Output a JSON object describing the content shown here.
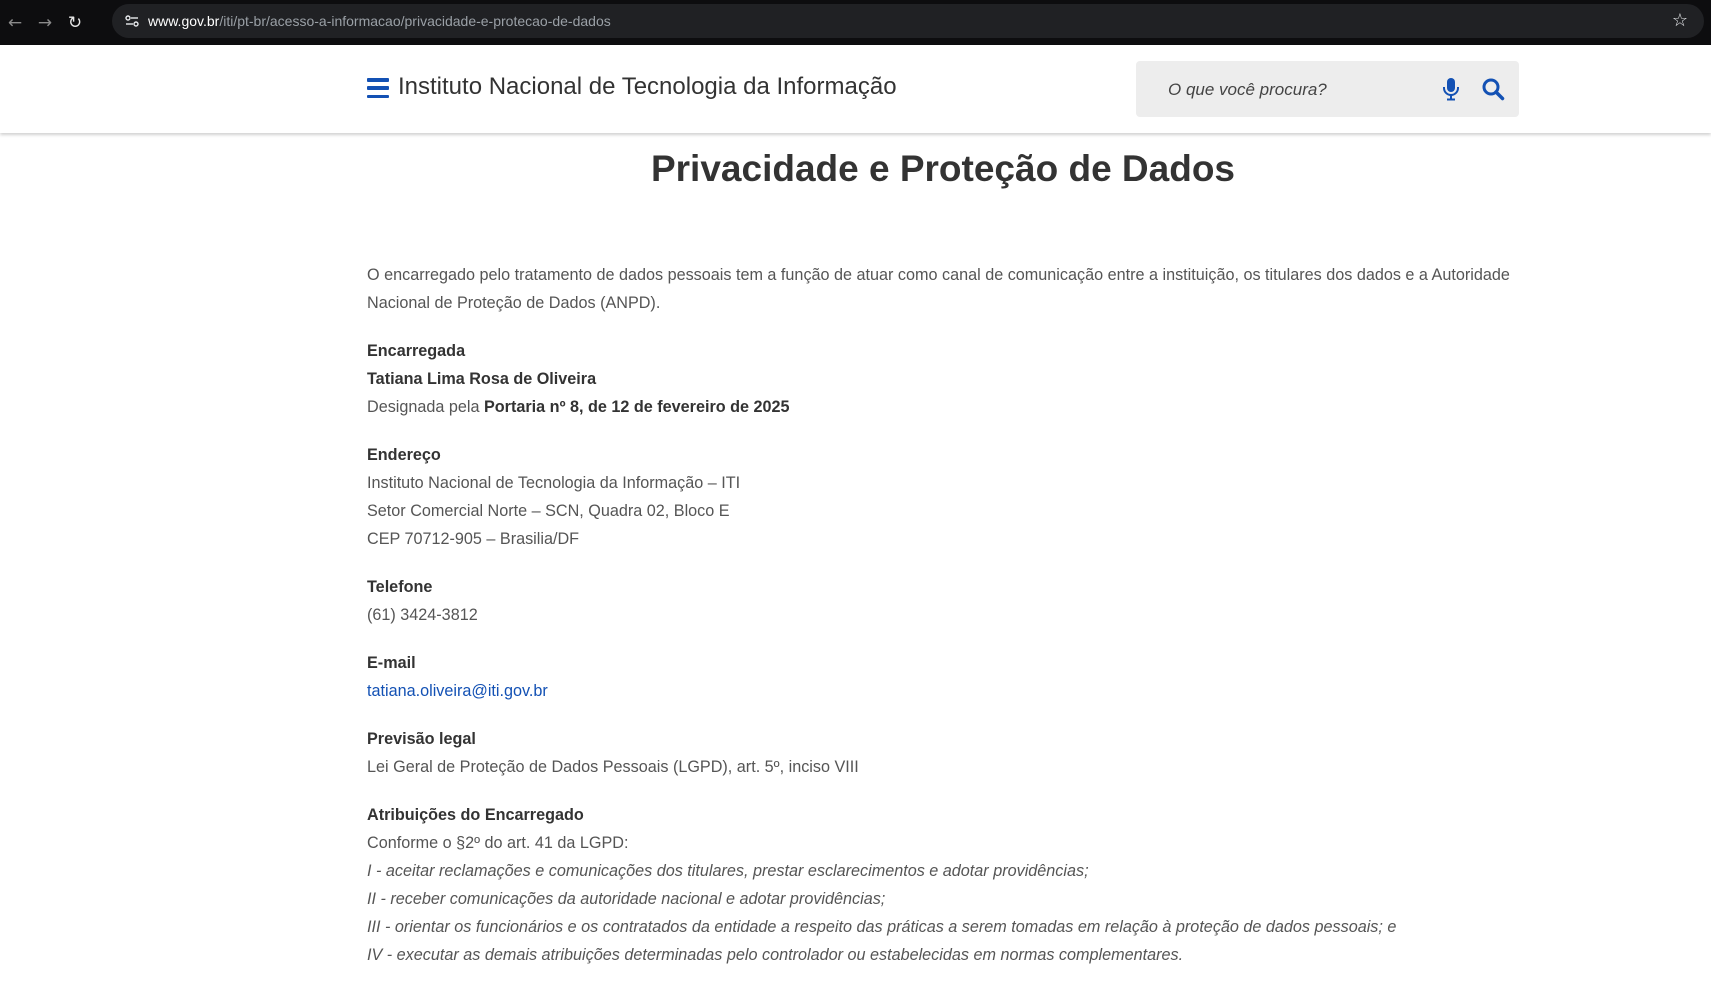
{
  "browser": {
    "url_host": "www.gov.br",
    "url_path": "/iti/pt-br/acesso-a-informacao/privacidade-e-protecao-de-dados"
  },
  "header": {
    "site_title": "Instituto Nacional de Tecnologia da Informação",
    "search_placeholder": "O que você procura?",
    "accent_color": "#1351b4"
  },
  "page": {
    "title": "Privacidade e Proteção de Dados",
    "intro": "O encarregado pelo tratamento de dados pessoais tem a função de atuar como canal de comunicação entre a instituição, os titulares dos dados e a Autoridade Nacional de Proteção de Dados (ANPD).",
    "encarregada": {
      "label": "Encarregada",
      "name": "Tatiana Lima Rosa de Oliveira",
      "designation_prefix": "Designada pela ",
      "designation_act": "Portaria nº 8, de 12 de fevereiro de 2025"
    },
    "endereco": {
      "label": "Endereço",
      "lines": [
        "Instituto Nacional de Tecnologia da Informação – ITI",
        "Setor Comercial Norte – SCN, Quadra 02, Bloco E",
        "CEP 70712-905 – Brasilia/DF"
      ]
    },
    "telefone": {
      "label": "Telefone",
      "value": "(61) 3424-3812"
    },
    "email": {
      "label": "E-mail",
      "value": "tatiana.oliveira@iti.gov.br"
    },
    "previsao_legal": {
      "label": "Previsão legal",
      "value": "Lei Geral de Proteção de Dados Pessoais (LGPD), art. 5º, inciso VIII"
    },
    "atribuicoes": {
      "label": "Atribuições do Encarregado",
      "intro": "Conforme o §2º do art. 41 da LGPD:",
      "items": [
        "I - aceitar reclamações e comunicações dos titulares, prestar esclarecimentos e adotar providências;",
        "II - receber comunicações da autoridade nacional e adotar providências;",
        "III - orientar os funcionários e os contratados da entidade a respeito das práticas a serem tomadas em relação à proteção de dados pessoais; e",
        "IV - executar as demais atribuições determinadas pelo controlador ou estabelecidas em normas complementares."
      ]
    }
  }
}
